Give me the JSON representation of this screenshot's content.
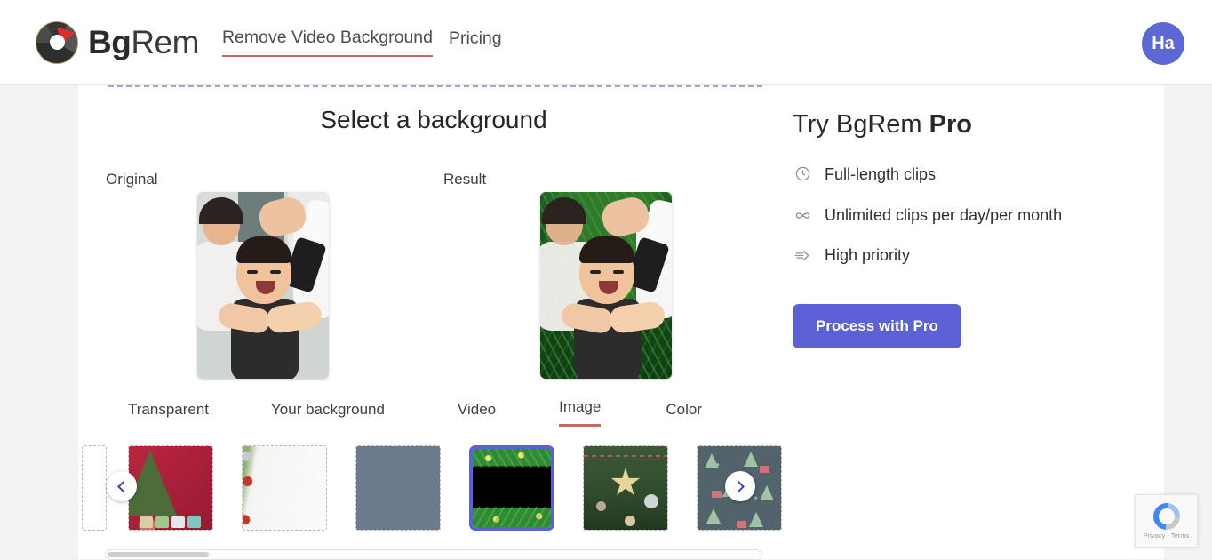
{
  "header": {
    "brand_bg": "Bg",
    "brand_rem": "Rem",
    "logo_icon": "camera-aperture-logo",
    "nav": [
      {
        "label": "Remove Video Background",
        "active": true
      },
      {
        "label": "Pricing",
        "active": false
      }
    ],
    "avatar_initials": "Ha",
    "avatar_color": "#5c68d4"
  },
  "main": {
    "section_title": "Select a background",
    "previews": [
      {
        "label": "Original",
        "alt": "baby getting a haircut, original photo"
      },
      {
        "label": "Result",
        "alt": "baby with green christmas garland background"
      }
    ],
    "tabs": [
      {
        "label": "Transparent",
        "active": false
      },
      {
        "label": "Your background",
        "active": false
      },
      {
        "label": "Video",
        "active": false
      },
      {
        "label": "Image",
        "active": true
      },
      {
        "label": "Color",
        "active": false
      }
    ],
    "tab_accent": "#c4695f",
    "carousel": {
      "prev_icon": "chevron-left-icon",
      "next_icon": "chevron-right-icon",
      "selected_index": 4,
      "selection_color": "#5c62d4",
      "thumbnails": [
        {
          "name": "partial-thumbnail",
          "alt": "partially visible background"
        },
        {
          "name": "red-christmas-tree-background",
          "alt": "red wall with christmas tree and gifts"
        },
        {
          "name": "white-wreath-background",
          "alt": "white background with wreath border"
        },
        {
          "name": "slate-gray-background",
          "alt": "solid slate gray"
        },
        {
          "name": "black-green-garland-background",
          "alt": "black background with green garland and lights"
        },
        {
          "name": "christmas-tree-star-background",
          "alt": "christmas tree with straw star ornament"
        },
        {
          "name": "tree-pattern-background",
          "alt": "dark teal with christmas tree pattern"
        }
      ]
    }
  },
  "pro_panel": {
    "title_prefix": "Try BgRem ",
    "title_bold": "Pro",
    "features": [
      {
        "icon": "clock-icon",
        "text": "Full-length clips"
      },
      {
        "icon": "infinity-icon",
        "text": "Unlimited clips per day/per month"
      },
      {
        "icon": "fast-forward-icon",
        "text": "High priority"
      }
    ],
    "cta_label": "Process with Pro",
    "cta_color": "#5c62d4"
  },
  "recaptcha": {
    "icon": "recaptcha-icon",
    "text": "Privacy - Terms"
  }
}
